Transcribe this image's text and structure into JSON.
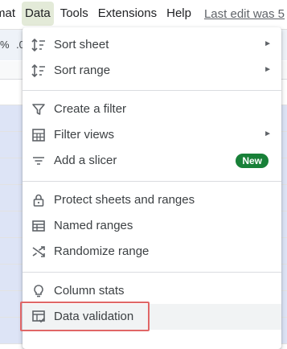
{
  "menubar": {
    "items": [
      "mat",
      "Data",
      "Tools",
      "Extensions",
      "Help"
    ],
    "last_edit": "Last edit was 5"
  },
  "toolbar": {
    "items": [
      "%",
      ".0"
    ]
  },
  "data_menu": {
    "items": [
      {
        "label": "Sort sheet",
        "icon": "sort-icon",
        "submenu": true
      },
      {
        "label": "Sort range",
        "icon": "sort-icon",
        "submenu": true
      },
      {
        "label": "Create a filter",
        "icon": "filter-icon"
      },
      {
        "label": "Filter views",
        "icon": "filter-views-icon",
        "submenu": true
      },
      {
        "label": "Add a slicer",
        "icon": "slicer-icon",
        "badge": "New"
      },
      {
        "label": "Protect sheets and ranges",
        "icon": "lock-icon"
      },
      {
        "label": "Named ranges",
        "icon": "named-ranges-icon"
      },
      {
        "label": "Randomize range",
        "icon": "shuffle-icon"
      },
      {
        "label": "Column stats",
        "icon": "lightbulb-icon"
      },
      {
        "label": "Data validation",
        "icon": "data-validation-icon",
        "highlighted": true
      }
    ],
    "submenu_arrow": "►"
  },
  "colors": {
    "active_menu_bg": "#e3ead8",
    "badge_bg": "#188038",
    "highlight_box": "#e06666",
    "selected_row": "#dde4f6"
  }
}
